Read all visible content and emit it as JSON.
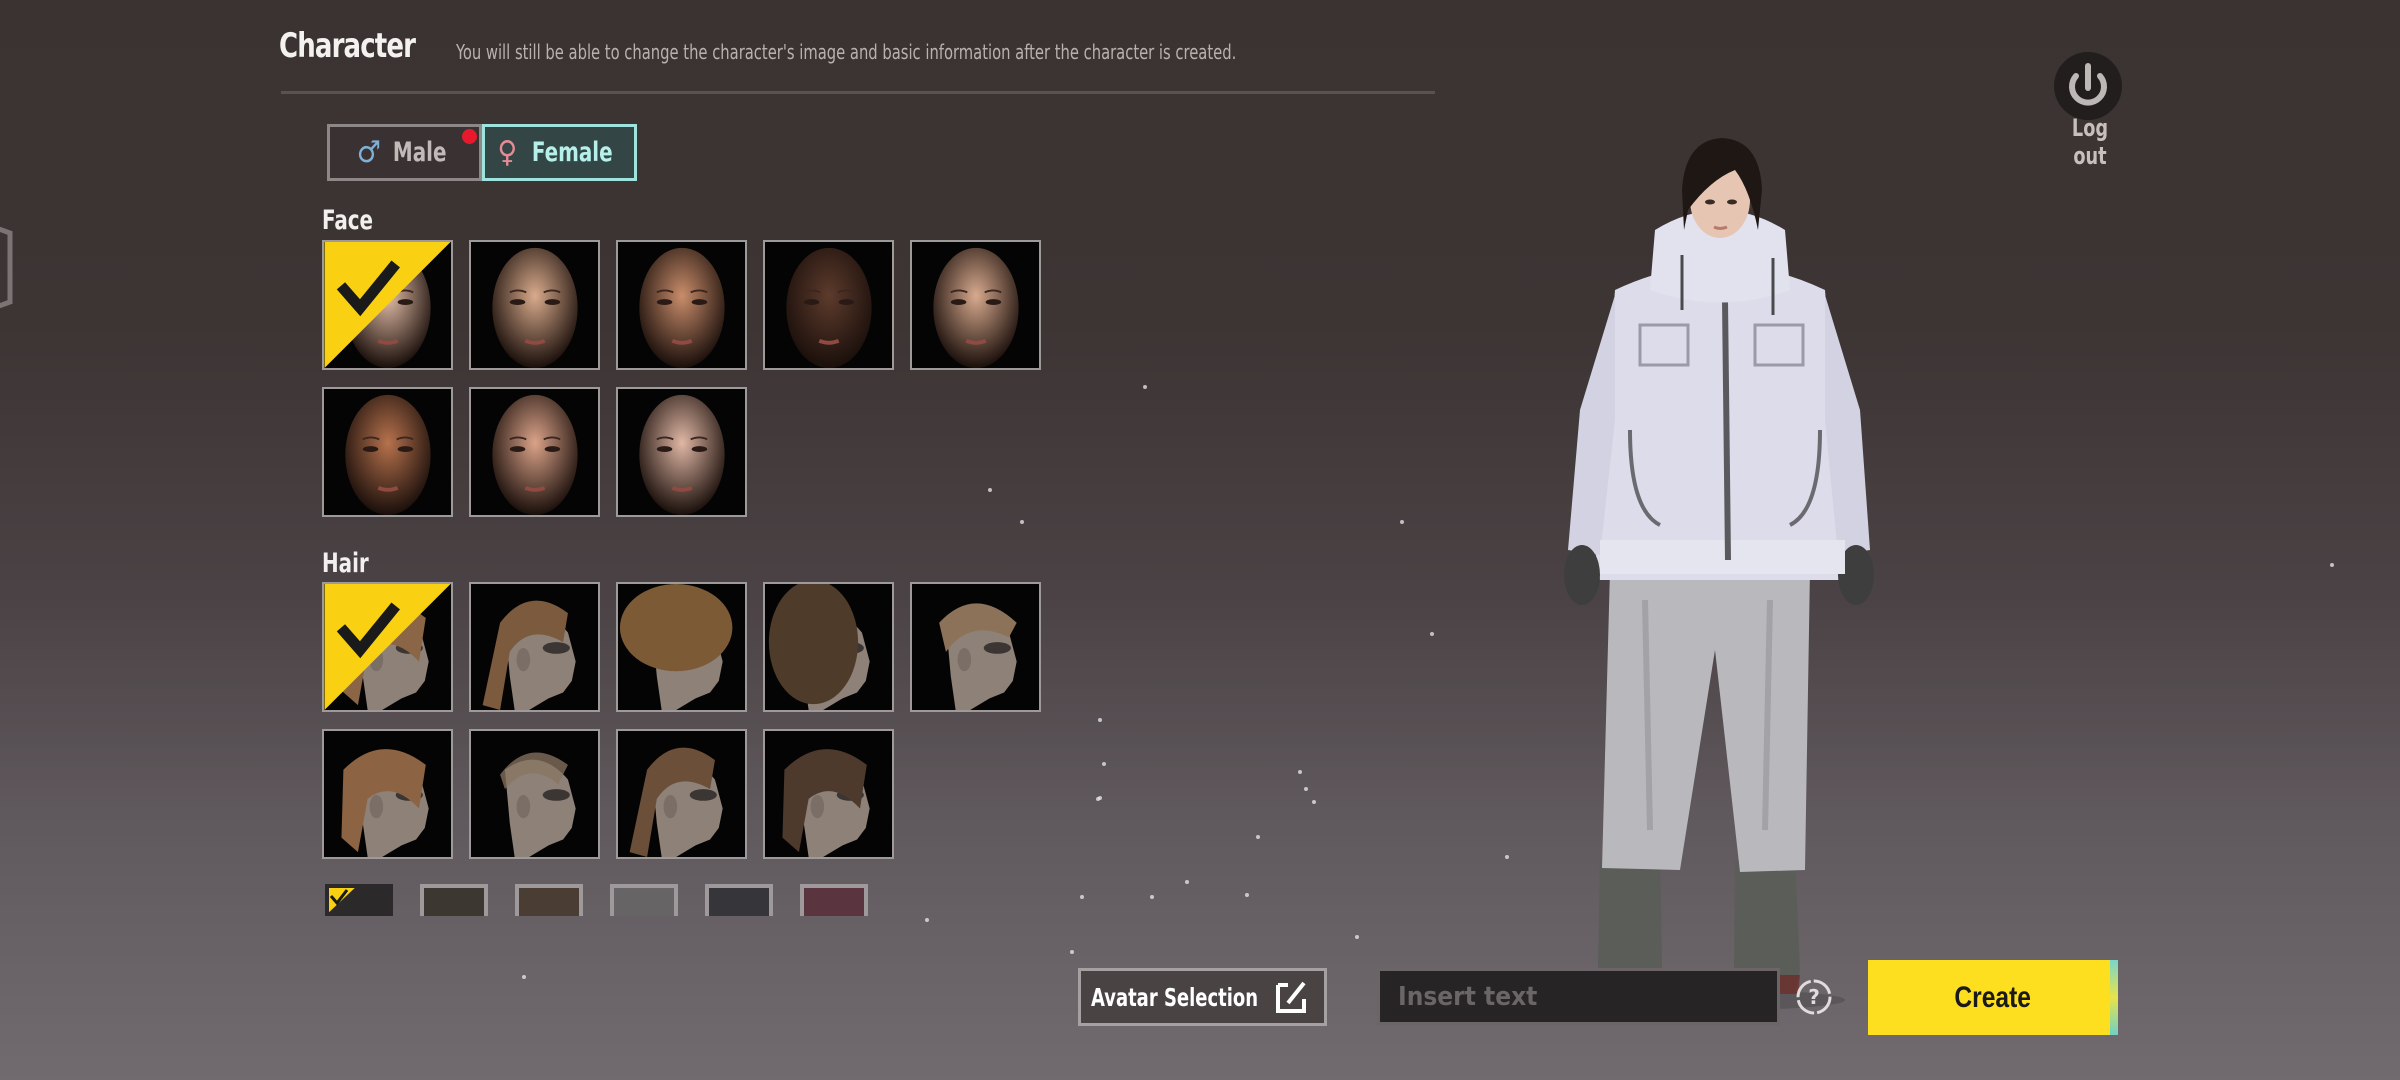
{
  "header": {
    "title": "Character",
    "subtitle": "You will still be able to change the character's image and basic information after the character is created."
  },
  "gender_tabs": [
    {
      "label": "Male",
      "icon": "male-symbol-icon",
      "symbol": "♂",
      "selected": false,
      "has_notification": true
    },
    {
      "label": "Female",
      "icon": "female-symbol-icon",
      "symbol": "♀",
      "selected": true,
      "has_notification": false
    }
  ],
  "face": {
    "label": "Face",
    "selected_index": 0,
    "options": [
      {
        "skin": "#e3bda7",
        "hair": "none"
      },
      {
        "skin": "#d9ab8c",
        "hair": "none"
      },
      {
        "skin": "#c98d6b",
        "hair": "none"
      },
      {
        "skin": "#5d3b2c",
        "hair": "none"
      },
      {
        "skin": "#d8aa8e",
        "hair": "none"
      },
      {
        "skin": "#b7724d",
        "hair": "none"
      },
      {
        "skin": "#dba389",
        "hair": "none"
      },
      {
        "skin": "#e0b7a5",
        "hair": "none"
      }
    ]
  },
  "hair": {
    "label": "Hair",
    "selected_index": 0,
    "options": [
      {
        "style": "bob",
        "color": "#8a6546"
      },
      {
        "style": "ponytail",
        "color": "#7b5a3e"
      },
      {
        "style": "afro",
        "color": "#7c5a36"
      },
      {
        "style": "curly",
        "color": "#4e3b2a"
      },
      {
        "style": "undercut",
        "color": "#8b7259"
      },
      {
        "style": "wavy",
        "color": "#8c6443"
      },
      {
        "style": "buzz",
        "color": "#8a7561"
      },
      {
        "style": "slick-ponytail",
        "color": "#6b4f39"
      },
      {
        "style": "side-swept",
        "color": "#4d3a2c"
      }
    ]
  },
  "hair_colors": {
    "selected_index": 0,
    "swatches": [
      "#2b2929",
      "#3d3731",
      "#4a3d33",
      "#666464",
      "#35353a",
      "#5a3540"
    ]
  },
  "logout": {
    "label": "Log out",
    "icon": "power-icon"
  },
  "bottom": {
    "avatar_button_label": "Avatar Selection",
    "avatar_button_icon": "edit-icon",
    "name_input_placeholder": "Insert text",
    "name_input_value": "",
    "help_icon": "help-circle-icon",
    "create_label": "Create"
  },
  "colors": {
    "accent_yellow": "#fedf1f",
    "female_accent": "#9ee3de",
    "notification_red": "#e8192c",
    "male_symbol": "#7fb0d6",
    "female_symbol": "#e48b97"
  }
}
